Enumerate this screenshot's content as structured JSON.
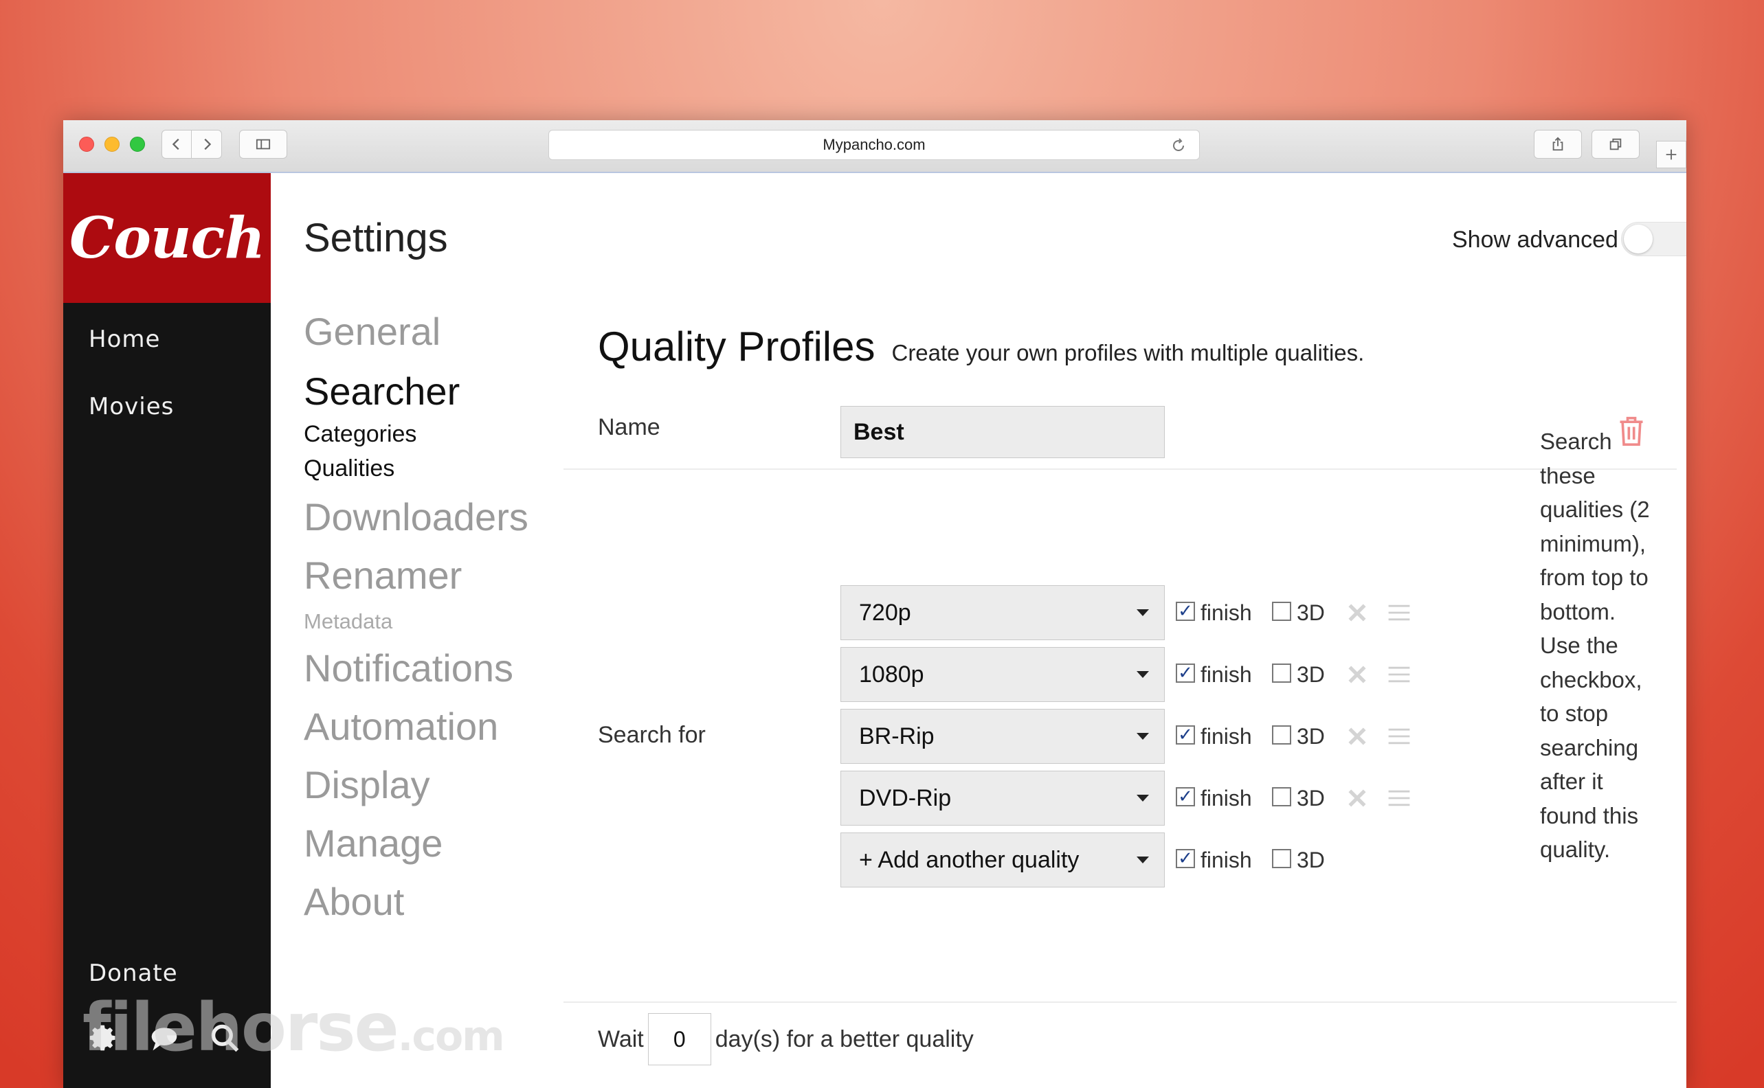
{
  "browser": {
    "url": "Mypancho.com"
  },
  "sidebar": {
    "logo": "Couch",
    "items": [
      {
        "label": "Home"
      },
      {
        "label": "Movies"
      }
    ],
    "donate": "Donate"
  },
  "settings": {
    "title": "Settings",
    "show_advanced": "Show advanced",
    "nav": [
      {
        "label": "General"
      },
      {
        "label": "Searcher"
      },
      {
        "label": "Categories"
      },
      {
        "label": "Qualities"
      },
      {
        "label": "Downloaders"
      },
      {
        "label": "Renamer"
      },
      {
        "label": "Metadata"
      },
      {
        "label": "Notifications"
      },
      {
        "label": "Automation"
      },
      {
        "label": "Display"
      },
      {
        "label": "Manage"
      },
      {
        "label": "About"
      }
    ]
  },
  "quality_profiles": {
    "title": "Quality Profiles",
    "description": "Create your own profiles with multiple qualities.",
    "name_label": "Name",
    "name_value": "Best",
    "search_label": "Search for",
    "finish_label": "finish",
    "three_d_label": "3D",
    "qualities": [
      {
        "value": "720p",
        "finish": true,
        "three_d": false
      },
      {
        "value": "1080p",
        "finish": true,
        "three_d": false
      },
      {
        "value": "BR-Rip",
        "finish": true,
        "three_d": false
      },
      {
        "value": "DVD-Rip",
        "finish": true,
        "three_d": false
      },
      {
        "value": "+ Add another quality",
        "finish": true,
        "three_d": false
      }
    ],
    "help_text": "Search these qualities (2 minimum), from top to bottom. Use the checkbox, to stop searching after it found this quality.",
    "wait_label": "Wait",
    "wait_value": "0",
    "wait_suffix": "day(s) for a better quality"
  },
  "watermark": {
    "text": "filehorse",
    "suffix": ".com"
  }
}
